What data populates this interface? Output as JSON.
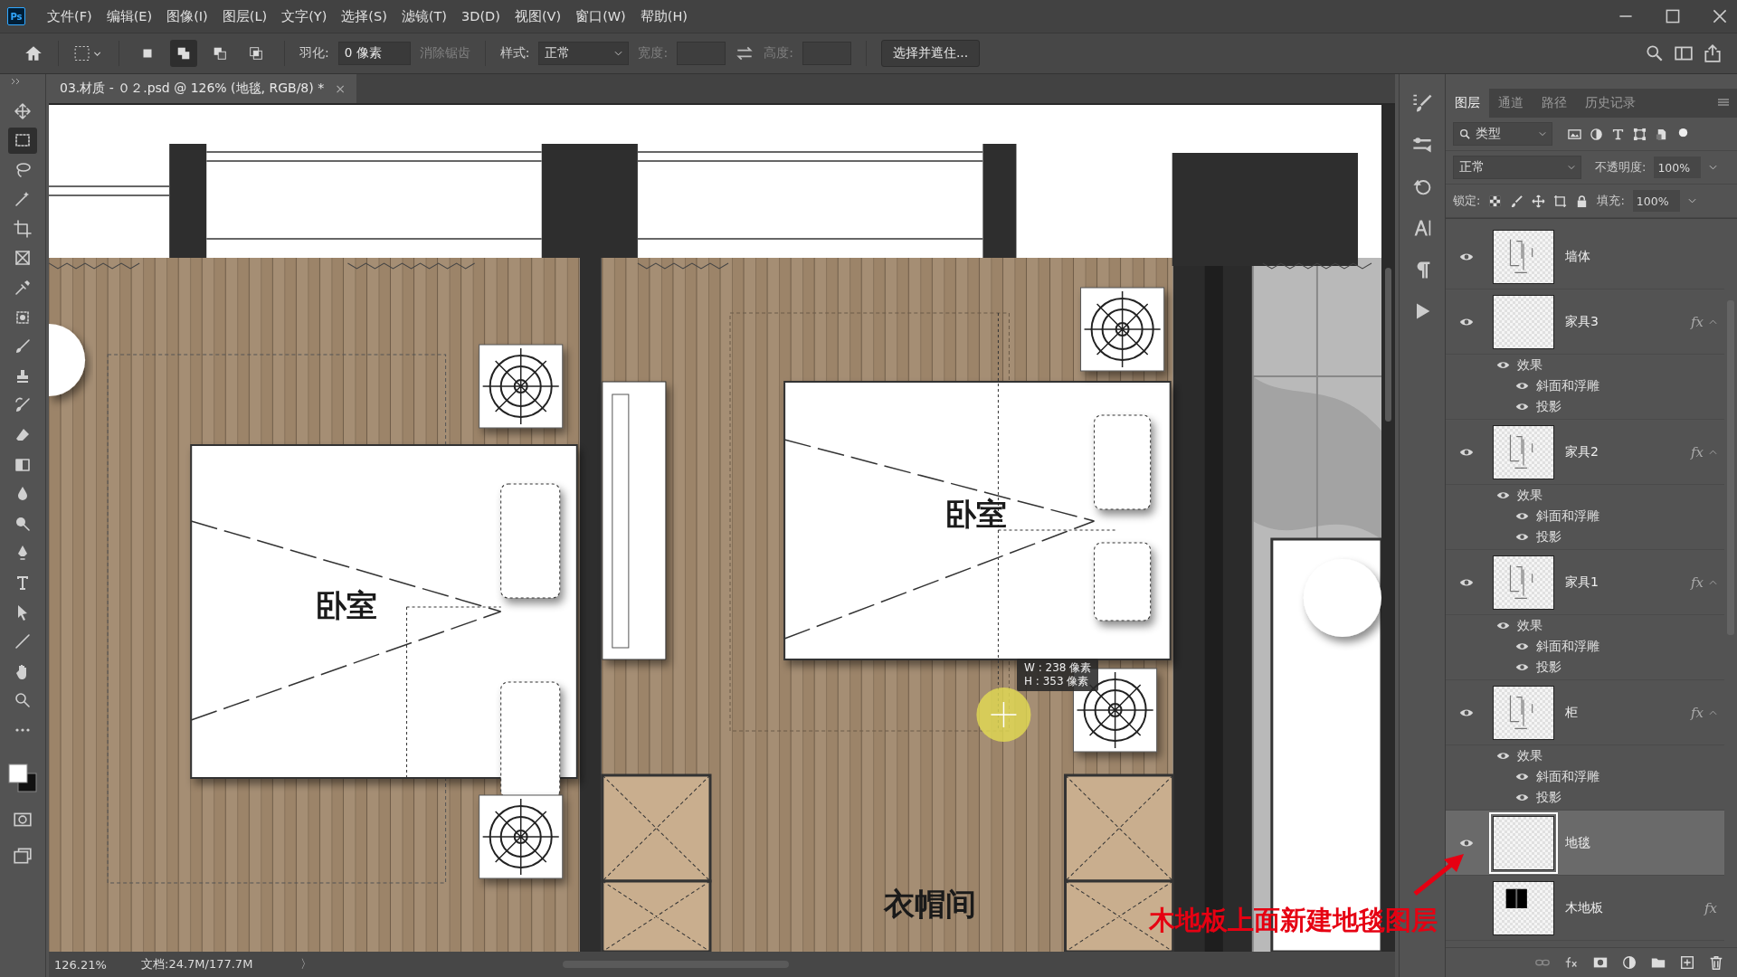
{
  "app": {
    "logo": "Ps"
  },
  "menu": [
    "文件(F)",
    "编辑(E)",
    "图像(I)",
    "图层(L)",
    "文字(Y)",
    "选择(S)",
    "滤镜(T)",
    "3D(D)",
    "视图(V)",
    "窗口(W)",
    "帮助(H)"
  ],
  "selection_modes": [
    {
      "selected": false
    },
    {
      "selected": true
    },
    {
      "selected": false
    },
    {
      "selected": false
    }
  ],
  "options": {
    "feather_label": "羽化:",
    "feather_value": "0 像素",
    "antialias": "消除锯齿",
    "antialias_disabled": true,
    "style_label": "样式:",
    "style_value": "正常",
    "width_label": "宽度:",
    "height_label": "高度:",
    "refine_button": "选择并遮住..."
  },
  "document_tab": {
    "title": "03.材质 - ０２.psd @ 126% (地毯, RGB/8) *",
    "close": "×"
  },
  "tools": [
    {
      "kind": "move",
      "selected": false
    },
    {
      "kind": "marquee",
      "selected": true
    },
    {
      "kind": "lasso",
      "selected": false
    },
    {
      "kind": "wand",
      "selected": false
    },
    {
      "kind": "crop",
      "selected": false
    },
    {
      "kind": "frame",
      "selected": false
    },
    {
      "kind": "eyedropper",
      "selected": false
    },
    {
      "kind": "patch",
      "selected": false
    },
    {
      "kind": "brush",
      "selected": false
    },
    {
      "kind": "stamp",
      "selected": false
    },
    {
      "kind": "history",
      "selected": false
    },
    {
      "kind": "eraser",
      "selected": false
    },
    {
      "kind": "gradient",
      "selected": false
    },
    {
      "kind": "blur",
      "selected": false
    },
    {
      "kind": "dodge",
      "selected": false
    },
    {
      "kind": "pen",
      "selected": false
    },
    {
      "kind": "type",
      "selected": false
    },
    {
      "kind": "pointer",
      "selected": false
    },
    {
      "kind": "line",
      "selected": false
    },
    {
      "kind": "hand",
      "selected": false
    },
    {
      "kind": "zoom",
      "selected": false
    },
    {
      "kind": "more",
      "selected": false
    }
  ],
  "canvas": {
    "room_labels": [
      "卧室",
      "卧室",
      "衣帽间"
    ],
    "size_tooltip": [
      "W : 238 像素",
      "H : 353 像素"
    ]
  },
  "annotation": "木地板上面新建地毯图层",
  "status": {
    "zoom": "126.21%",
    "doc": "文档:24.7M/177.7M",
    "arrow": "〉"
  },
  "panel_tabs": [
    {
      "label": "图层",
      "selected": true
    },
    {
      "label": "通道",
      "selected": false
    },
    {
      "label": "路径",
      "selected": false
    },
    {
      "label": "历史记录",
      "selected": false
    }
  ],
  "layer_controls": {
    "filter": "类型",
    "blend": "正常",
    "opacity_label": "不透明度:",
    "opacity": "100%",
    "lock_label": "锁定:",
    "fill_label": "填充:",
    "fill": "100%"
  },
  "layers": [
    {
      "name": "墙体",
      "visible": true,
      "selected": false,
      "kind": "sketch"
    },
    {
      "name": "家具3",
      "visible": true,
      "selected": false,
      "kind": "blank",
      "fx": "fx",
      "effects": {
        "label": "效果",
        "visible": true,
        "items": [
          {
            "name": "斜面和浮雕",
            "visible": true
          },
          {
            "name": "投影",
            "visible": true
          }
        ]
      }
    },
    {
      "name": "家具2",
      "visible": true,
      "selected": false,
      "kind": "sketch",
      "fx": "fx",
      "effects": {
        "label": "效果",
        "visible": true,
        "items": [
          {
            "name": "斜面和浮雕",
            "visible": true
          },
          {
            "name": "投影",
            "visible": true
          }
        ]
      }
    },
    {
      "name": "家具1",
      "visible": true,
      "selected": false,
      "kind": "sketch",
      "fx": "fx",
      "effects": {
        "label": "效果",
        "visible": true,
        "items": [
          {
            "name": "斜面和浮雕",
            "visible": true
          },
          {
            "name": "投影",
            "visible": true
          }
        ]
      }
    },
    {
      "name": "柜",
      "visible": true,
      "selected": false,
      "kind": "sketch",
      "fx": "fx",
      "effects": {
        "label": "效果",
        "visible": true,
        "items": [
          {
            "name": "斜面和浮雕",
            "visible": true
          },
          {
            "name": "投影",
            "visible": true
          }
        ]
      }
    },
    {
      "name": "地毯",
      "visible": true,
      "selected": true,
      "kind": "blank"
    },
    {
      "name": "木地板",
      "selected": false,
      "kind": "block",
      "fx": "fx"
    }
  ]
}
